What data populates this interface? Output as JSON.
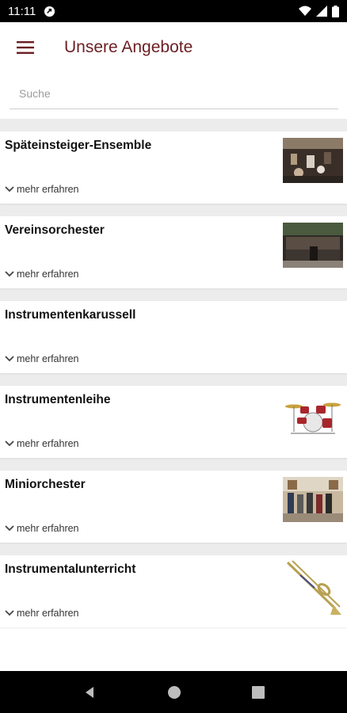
{
  "status_bar": {
    "time": "11:11"
  },
  "app_bar": {
    "title": "Unsere Angebote"
  },
  "search": {
    "placeholder": "Suche"
  },
  "items": [
    {
      "title": "Späteinsteiger-Ensemble",
      "more": "mehr erfahren",
      "image": "ensemble-photo"
    },
    {
      "title": "Vereinsorchester",
      "more": "mehr erfahren",
      "image": "orchestra-photo"
    },
    {
      "title": "Instrumentenkarussell",
      "more": "mehr erfahren",
      "image": ""
    },
    {
      "title": "Instrumentenleihe",
      "more": "mehr erfahren",
      "image": "drum-kit-image"
    },
    {
      "title": "Miniorchester",
      "more": "mehr erfahren",
      "image": "mini-orchestra-photo"
    },
    {
      "title": "Instrumentalunterricht",
      "more": "mehr erfahren",
      "image": "trombone-image"
    }
  ],
  "colors": {
    "title": "#6b1f23",
    "divider": "#ececec"
  }
}
